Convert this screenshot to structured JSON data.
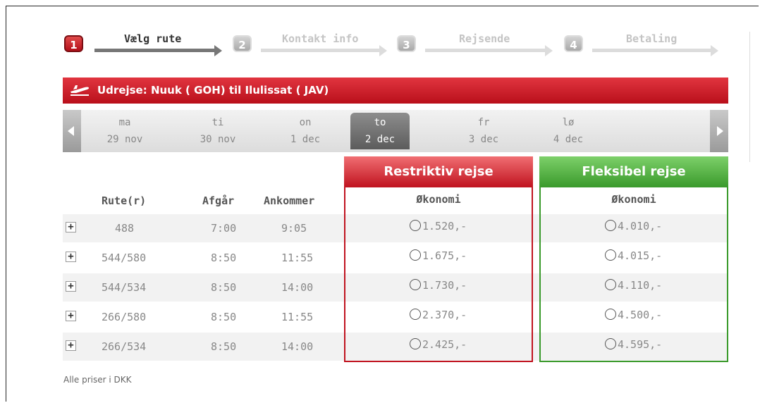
{
  "steps": [
    {
      "num": "1",
      "label": "Vælg rute",
      "active": true
    },
    {
      "num": "2",
      "label": "Kontakt info",
      "active": false
    },
    {
      "num": "3",
      "label": "Rejsende",
      "active": false
    },
    {
      "num": "4",
      "label": "Betaling",
      "active": false
    }
  ],
  "banner": {
    "text": "Udrejse: Nuuk ( GOH)  til  Ilulissat ( JAV)",
    "icon": "airplane-icon"
  },
  "dates": [
    {
      "day": "ma",
      "date": "29 nov"
    },
    {
      "day": "ti",
      "date": "30 nov"
    },
    {
      "day": "on",
      "date": "1 dec"
    },
    {
      "day": "to",
      "date": "2 dec",
      "selected": true
    },
    {
      "day": "fr",
      "date": "3 dec"
    },
    {
      "day": "lø",
      "date": "4 dec"
    }
  ],
  "table": {
    "headers": {
      "route": "Rute(r)",
      "depart": "Afgår",
      "arrive": "Ankommer"
    },
    "rows": [
      {
        "route": "488",
        "depart": "7:00",
        "arrive": "9:05",
        "restrictive": "1.520,-",
        "flexible": "4.010,-"
      },
      {
        "route": "544/580",
        "depart": "8:50",
        "arrive": "11:55",
        "restrictive": "1.675,-",
        "flexible": "4.015,-"
      },
      {
        "route": "544/534",
        "depart": "8:50",
        "arrive": "14:00",
        "restrictive": "1.730,-",
        "flexible": "4.110,-"
      },
      {
        "route": "266/580",
        "depart": "8:50",
        "arrive": "11:55",
        "restrictive": "2.370,-",
        "flexible": "4.500,-"
      },
      {
        "route": "266/534",
        "depart": "8:50",
        "arrive": "14:00",
        "restrictive": "2.425,-",
        "flexible": "4.595,-"
      }
    ]
  },
  "fares": {
    "restrictive": {
      "title": "Restriktiv rejse",
      "class": "Økonomi",
      "color": "#c0131f"
    },
    "flexible": {
      "title": "Fleksibel rejse",
      "class": "Økonomi",
      "color": "#3a9a2b"
    }
  },
  "footer": {
    "note": "Alle priser i DKK"
  }
}
